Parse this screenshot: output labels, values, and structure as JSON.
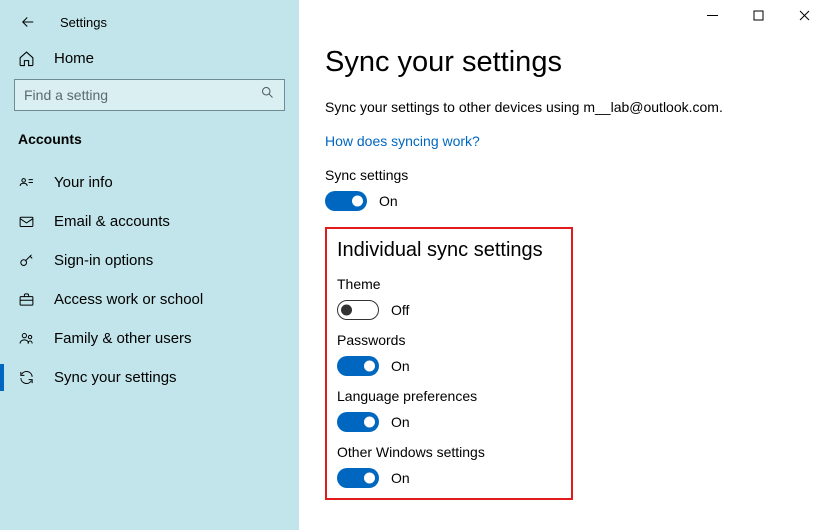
{
  "app": {
    "title": "Settings"
  },
  "sidebar": {
    "home": "Home",
    "search_placeholder": "Find a setting",
    "section": "Accounts",
    "items": [
      {
        "label": "Your info"
      },
      {
        "label": "Email & accounts"
      },
      {
        "label": "Sign-in options"
      },
      {
        "label": "Access work or school"
      },
      {
        "label": "Family & other users"
      },
      {
        "label": "Sync your settings"
      }
    ]
  },
  "main": {
    "title": "Sync your settings",
    "description": "Sync your settings to other devices using m__lab@outlook.com.",
    "link": "How does syncing work?",
    "sync_settings_label": "Sync settings",
    "sync_settings_state": "On",
    "individual_heading": "Individual sync settings",
    "items": [
      {
        "label": "Theme",
        "on": false,
        "state": "Off"
      },
      {
        "label": "Passwords",
        "on": true,
        "state": "On"
      },
      {
        "label": "Language preferences",
        "on": true,
        "state": "On"
      },
      {
        "label": "Other Windows settings",
        "on": true,
        "state": "On"
      }
    ]
  }
}
